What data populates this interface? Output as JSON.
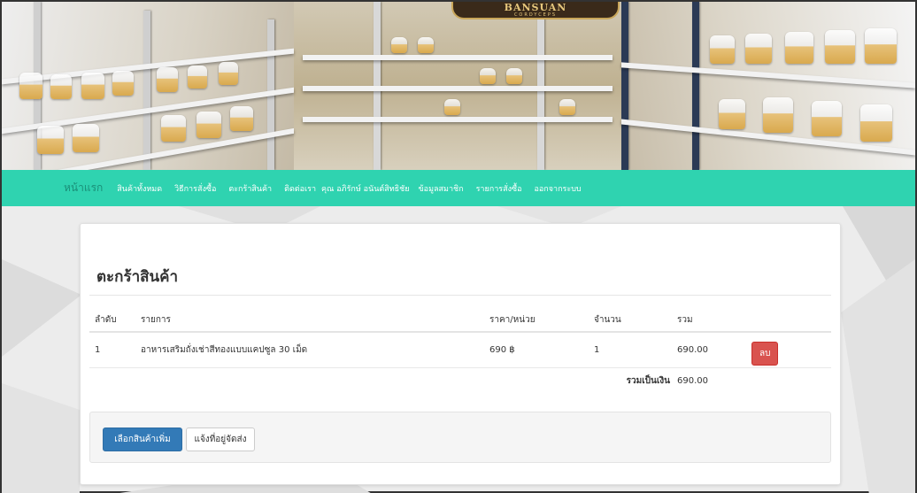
{
  "banner": {
    "logo_title": "BANSUAN",
    "logo_subtitle": "CORDYCEPS"
  },
  "nav": {
    "home": "หน้าแรก",
    "all_products": "สินค้าทั้งหมด",
    "how_to_order": "วิธีการสั่งซื้อ",
    "cart": "ตะกร้าสินค้า",
    "contact": "ติดต่อเรา",
    "user_name": "คุณ อภิรักษ์ อนันต์สิทธิชัย",
    "member_info": "ข้อมูลสมาชิก",
    "order_list": "รายการสั่งซื้อ",
    "logout": "ออกจากระบบ"
  },
  "cart": {
    "title": "ตะกร้าสินค้า",
    "columns": {
      "index": "ลำดับ",
      "item": "รายการ",
      "unit_price": "ราคา/หน่วย",
      "quantity": "จำนวน",
      "total": "รวม"
    },
    "rows": [
      {
        "index": "1",
        "item": "อาหารเสริมถั่งเช่าสีทองแบบแคปซูล 30 เม็ด",
        "unit_price": "690 ฿",
        "quantity": "1",
        "total": "690.00",
        "delete_label": "ลบ"
      }
    ],
    "grand_total_label": "รวมเป็นเงิน",
    "grand_total": "690.00",
    "continue_shopping": "เลือกสินค้าเพิ่ม",
    "shipping_address": "แจ้งที่อยู่จัดส่ง"
  },
  "colors": {
    "navbar": "#2fd3b0",
    "primary_button": "#337ab7",
    "danger_button": "#d9534f"
  }
}
